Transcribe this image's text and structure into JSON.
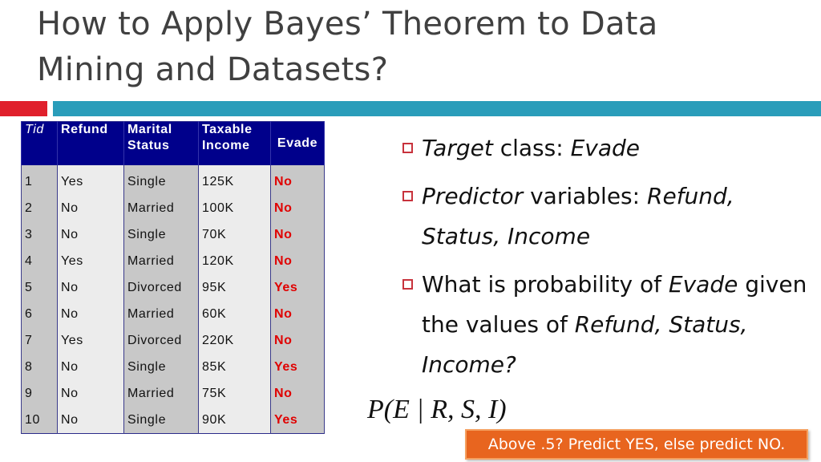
{
  "slide": {
    "title": "How to Apply Bayes’ Theorem to Data Mining and Datasets?",
    "accent_colors": {
      "red": "#e0202c",
      "teal": "#2a9dba",
      "table_header": "#00008b",
      "class_label": "#e00000",
      "callout": "#e8651f"
    }
  },
  "table": {
    "headers": [
      "Tid",
      "Refund",
      "Marital Status",
      "Taxable Income",
      "Evade"
    ],
    "rows": [
      [
        "1",
        "Yes",
        "Single",
        "125K",
        "No"
      ],
      [
        "2",
        "No",
        "Married",
        "100K",
        "No"
      ],
      [
        "3",
        "No",
        "Single",
        "70K",
        "No"
      ],
      [
        "4",
        "Yes",
        "Married",
        "120K",
        "No"
      ],
      [
        "5",
        "No",
        "Divorced",
        "95K",
        "Yes"
      ],
      [
        "6",
        "No",
        "Married",
        "60K",
        "No"
      ],
      [
        "7",
        "Yes",
        "Divorced",
        "220K",
        "No"
      ],
      [
        "8",
        "No",
        "Single",
        "85K",
        "Yes"
      ],
      [
        "9",
        "No",
        "Married",
        "75K",
        "No"
      ],
      [
        "10",
        "No",
        "Single",
        "90K",
        "Yes"
      ]
    ]
  },
  "bullets": [
    {
      "parts": [
        {
          "t": "Target",
          "i": true
        },
        {
          "t": " class: ",
          "i": false
        },
        {
          "t": "Evade",
          "i": true
        }
      ]
    },
    {
      "parts": [
        {
          "t": "Predictor",
          "i": true
        },
        {
          "t": " variables: ",
          "i": false
        },
        {
          "t": "Refund, Status, Income",
          "i": true
        }
      ]
    },
    {
      "parts": [
        {
          "t": "What is probability of ",
          "i": false
        },
        {
          "t": "Evade",
          "i": true
        },
        {
          "t": " given the values of ",
          "i": false
        },
        {
          "t": "Refund, Status, Income?",
          "i": true
        }
      ]
    }
  ],
  "formula": "P(E | R, S, I)",
  "callout": "Above .5? Predict YES, else predict NO."
}
